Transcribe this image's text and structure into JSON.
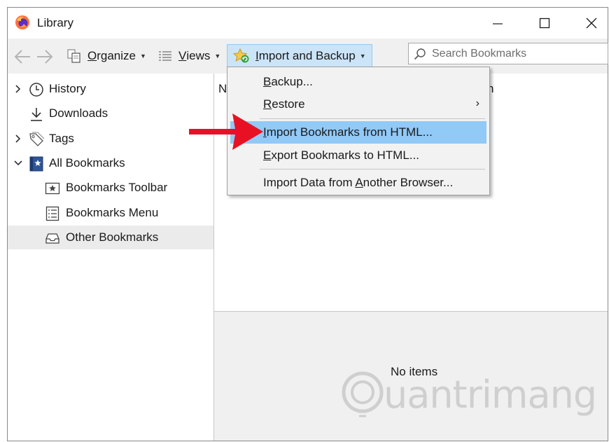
{
  "window": {
    "title": "Library"
  },
  "toolbar": {
    "organize": {
      "prefix": "",
      "mnemonic": "O",
      "rest": "rganize"
    },
    "views": {
      "mnemonic": "V",
      "rest": "iews"
    },
    "import_backup": {
      "mnemonic": "I",
      "rest": "mport and Backup"
    }
  },
  "search": {
    "placeholder": "Search Bookmarks",
    "value": ""
  },
  "sidebar": {
    "items": [
      {
        "label": "History"
      },
      {
        "label": "Downloads"
      },
      {
        "label": "Tags"
      },
      {
        "label": "All Bookmarks"
      },
      {
        "label": "Bookmarks Toolbar"
      },
      {
        "label": "Bookmarks Menu"
      },
      {
        "label": "Other Bookmarks"
      }
    ]
  },
  "content": {
    "column_a": "N",
    "column_b": "n",
    "empty_text": "No items"
  },
  "menu": {
    "backup": {
      "mnemonic": "B",
      "rest": "ackup..."
    },
    "restore": {
      "mnemonic": "R",
      "rest": "estore",
      "submenu_glyph": "›"
    },
    "import_html": {
      "mnemonic": "I",
      "rest": "mport Bookmarks from HTML..."
    },
    "export_html": {
      "mnemonic": "E",
      "rest": "xport Bookmarks to HTML..."
    },
    "import_data": {
      "before": "Import Data from ",
      "mnemonic": "A",
      "rest": "nother Browser..."
    }
  },
  "watermark": {
    "text": "uantrimang"
  },
  "colors": {
    "accent_hover": "#91c9f7",
    "toolbar_active": "#cce4f7",
    "arrow": "#e81123",
    "selected_row": "#ebebeb"
  }
}
